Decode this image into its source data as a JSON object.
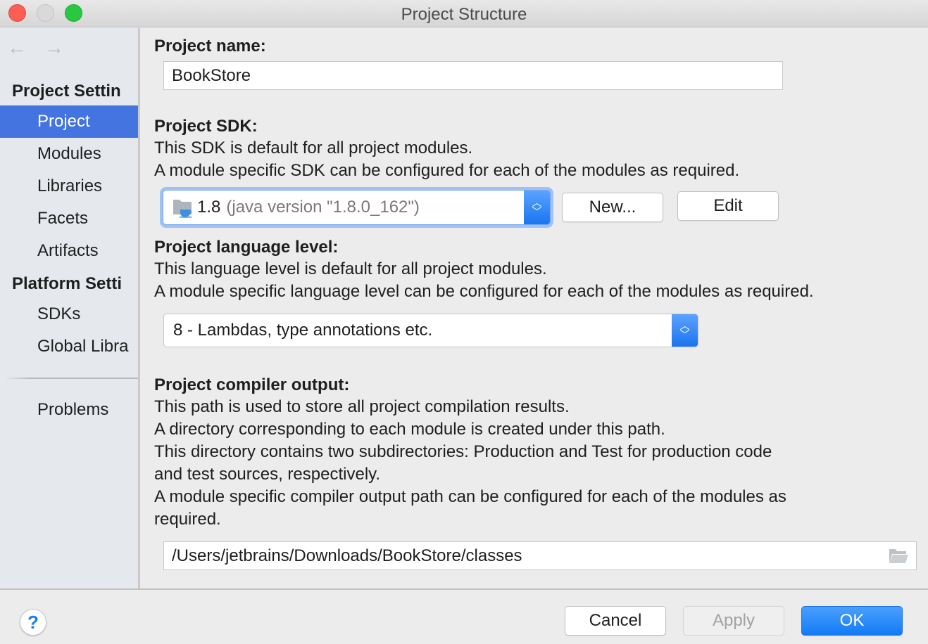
{
  "window": {
    "title": "Project Structure"
  },
  "sidebar": {
    "back_icon": "←",
    "forward_icon": "→",
    "project_settings_heading": "Project Settin",
    "project_items": [
      {
        "label": "Project",
        "selected": true
      },
      {
        "label": "Modules"
      },
      {
        "label": "Libraries"
      },
      {
        "label": "Facets"
      },
      {
        "label": "Artifacts"
      }
    ],
    "platform_settings_heading": "Platform Setti",
    "platform_items": [
      {
        "label": "SDKs"
      },
      {
        "label": "Global Libra"
      }
    ],
    "problems_label": "Problems"
  },
  "project_name": {
    "label": "Project name:",
    "value": "BookStore"
  },
  "project_sdk": {
    "label": "Project SDK:",
    "desc_lines": [
      "This SDK is default for all project modules.",
      "A module specific SDK can be configured for each of the modules as required."
    ],
    "selected_version": "1.8",
    "selected_detail": "(java version \"1.8.0_162\")",
    "new_button": "New...",
    "edit_button": "Edit"
  },
  "language_level": {
    "label": "Project language level:",
    "desc_lines": [
      "This language level is default for all project modules.",
      "A module specific language level can be configured for each of the modules as required."
    ],
    "selected": "8 - Lambdas, type annotations etc."
  },
  "compiler_output": {
    "label": "Project compiler output:",
    "desc_lines": [
      "This path is used to store all project compilation results.",
      "A directory corresponding to each module is created under this path.",
      "This directory contains two subdirectories: Production and Test for production code",
      "and test sources, respectively.",
      "A module specific compiler output path can be configured for each of the modules as",
      "required."
    ],
    "path": "/Users/jetbrains/Downloads/BookStore/classes"
  },
  "footer": {
    "help_label": "?",
    "cancel": "Cancel",
    "apply": "Apply",
    "ok": "OK"
  },
  "colors": {
    "selection": "#4374e0",
    "primary_button": "#137bf5",
    "focus_ring": "#9ec2f3"
  }
}
